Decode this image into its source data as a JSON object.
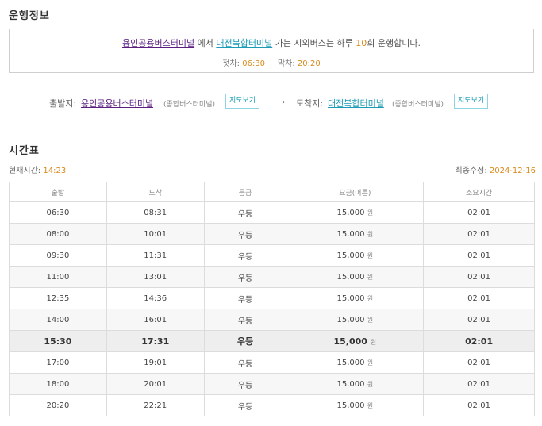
{
  "operation": {
    "title": "운행정보",
    "origin": "용인공용버스터미널",
    "from_word": "에서",
    "destination": "대전복합터미널",
    "desc_mid": "가는 시외버스는 하루",
    "count": "10",
    "desc_end": "회 운행합니다.",
    "first_label": "첫차:",
    "first_time": "06:30",
    "last_label": "막차:",
    "last_time": "20:20"
  },
  "route": {
    "dep_label": "출발지:",
    "dep_name": "용인공용버스터미널",
    "dep_type": "(종합버스터미널)",
    "map_label": "지도보기",
    "arrow": "→",
    "arr_label": "도착지:",
    "arr_name": "대전복합터미널",
    "arr_type": "(종합버스터미널)"
  },
  "timetable": {
    "title": "시간표",
    "now_label": "현재시간:",
    "now_time": "14:23",
    "updated_label": "최종수정:",
    "updated_date": "2024-12-16",
    "headers": [
      "출발",
      "도착",
      "등급",
      "요금(어른)",
      "소요시간"
    ],
    "won": "원",
    "rows": [
      {
        "dep": "06:30",
        "arr": "08:31",
        "grade": "우등",
        "fare": "15,000",
        "dur": "02:01"
      },
      {
        "dep": "08:00",
        "arr": "10:01",
        "grade": "우등",
        "fare": "15,000",
        "dur": "02:01"
      },
      {
        "dep": "09:30",
        "arr": "11:31",
        "grade": "우등",
        "fare": "15,000",
        "dur": "02:01"
      },
      {
        "dep": "11:00",
        "arr": "13:01",
        "grade": "우등",
        "fare": "15,000",
        "dur": "02:01"
      },
      {
        "dep": "12:35",
        "arr": "14:36",
        "grade": "우등",
        "fare": "15,000",
        "dur": "02:01"
      },
      {
        "dep": "14:00",
        "arr": "16:01",
        "grade": "우등",
        "fare": "15,000",
        "dur": "02:01"
      },
      {
        "dep": "15:30",
        "arr": "17:31",
        "grade": "우등",
        "fare": "15,000",
        "dur": "02:01",
        "highlight": true
      },
      {
        "dep": "17:00",
        "arr": "19:01",
        "grade": "우등",
        "fare": "15,000",
        "dur": "02:01"
      },
      {
        "dep": "18:00",
        "arr": "20:01",
        "grade": "우등",
        "fare": "15,000",
        "dur": "02:01"
      },
      {
        "dep": "20:20",
        "arr": "22:21",
        "grade": "우등",
        "fare": "15,000",
        "dur": "02:01"
      }
    ]
  }
}
